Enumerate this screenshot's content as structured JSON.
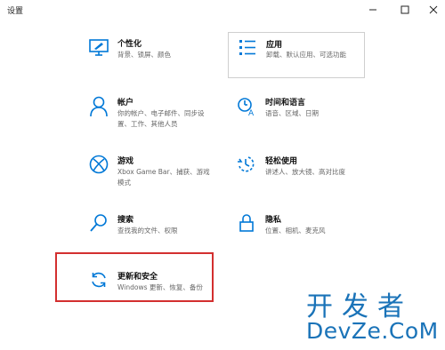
{
  "window": {
    "title": "设置"
  },
  "tiles": [
    {
      "name": "个性化",
      "desc": "背景、锁屏、颜色",
      "icon": "personalization-icon"
    },
    {
      "name": "应用",
      "desc": "卸载、默认应用、可选功能",
      "icon": "apps-icon"
    },
    {
      "name": "帐户",
      "desc": "你的帐户、电子邮件、同步设置、工作、其他人员",
      "icon": "account-icon"
    },
    {
      "name": "时间和语言",
      "desc": "语音、区域、日期",
      "icon": "time-language-icon"
    },
    {
      "name": "游戏",
      "desc": "Xbox Game Bar、捕获、游戏模式",
      "icon": "xbox-icon"
    },
    {
      "name": "轻松使用",
      "desc": "讲述人、放大镜、高对比度",
      "icon": "ease-of-access-icon"
    },
    {
      "name": "搜索",
      "desc": "查找我的文件、权限",
      "icon": "search-icon"
    },
    {
      "name": "隐私",
      "desc": "位置、相机、麦克风",
      "icon": "privacy-lock-icon"
    },
    {
      "name": "更新和安全",
      "desc": "Windows 更新、恢复、备份",
      "icon": "update-sync-icon"
    }
  ],
  "colors": {
    "accent": "#0078d7",
    "highlight_border": "#d32f2f",
    "watermark": "#1a73b8"
  },
  "watermark": {
    "line1": "开发者",
    "line2": "DevZe.CoM"
  }
}
